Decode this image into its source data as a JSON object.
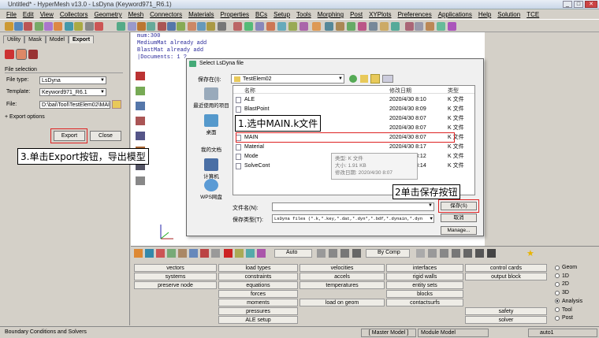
{
  "window": {
    "title": "Untitled* - HyperMesh v13.0 - LsDyna (Keyword971_R6.1)"
  },
  "menu": [
    "File",
    "Edit",
    "View",
    "Collectors",
    "Geometry",
    "Mesh",
    "Connectors",
    "Materials",
    "Properties",
    "BCs",
    "Setup",
    "Tools",
    "Morphing",
    "Post",
    "XYPlots",
    "Preferences",
    "Applications",
    "Help",
    "Solution",
    "TCE"
  ],
  "left_panel": {
    "tabs": [
      "Utility",
      "Mask",
      "Model",
      "Export"
    ],
    "section": "File selection",
    "file_type_label": "File type:",
    "file_type_value": "LsDyna",
    "template_label": "Template:",
    "template_value": "Keyword971_R6.1",
    "file_label": "File:",
    "file_value": "D:\\bai\\Tool\\TestElem02\\MAIN.k",
    "export_options": "Export options",
    "export_button": "Export",
    "close_button": "Close"
  },
  "console": [
    "mum:300",
    "MediumMat already add",
    "BlastMat already add",
    "|Documents: 1 ?"
  ],
  "dialog": {
    "title": "Select LsDyna file",
    "save_in_label": "保存在(I):",
    "save_in_value": "TestElem02",
    "places": [
      "最近使用的项目",
      "桌面",
      "我的文档",
      "计算机",
      "WPS网盘"
    ],
    "columns": [
      "名称",
      "修改日期",
      "类型"
    ],
    "files": [
      {
        "name": "ALE",
        "date": "2020/4/30 8:10",
        "type": "K 文件"
      },
      {
        "name": "BlastPoint",
        "date": "2020/4/30 8:09",
        "type": "K 文件"
      },
      {
        "name": "Boundary",
        "date": "2020/4/30 8:07",
        "type": "K 文件"
      },
      {
        "name": "Definition",
        "date": "2020/4/30 8:07",
        "type": "K 文件"
      },
      {
        "name": "MAIN",
        "date": "2020/4/30 8:07",
        "type": "K 文件"
      },
      {
        "name": "Material",
        "date": "2020/4/30 8:17",
        "type": "K 文件"
      },
      {
        "name": "Mode",
        "date": "2020/4/30 8:12",
        "type": "K 文件"
      },
      {
        "name": "SolveCont",
        "date": "2020/4/30 8:14",
        "type": "K 文件"
      }
    ],
    "tooltip": [
      "类型: K 文件",
      "大小: 1.91 KB",
      "修改日期: 2020/4/30 8:07"
    ],
    "filename_label": "文件名(N):",
    "filename_value": "",
    "savetype_label": "保存类型(T):",
    "savetype_value": "LsDyna files (*.k,*.key,*.dat,*.dyn*,*.bdf,*.dynain,*.dyn",
    "save_button": "保存(S)",
    "cancel_button": "取消",
    "manage_button": "Manage..."
  },
  "annotations": {
    "step1": "1.选中MAIN.k文件",
    "step2": "2单击保存按钮",
    "step3": "3.单击Export按钮，导出模型"
  },
  "bottom_toolbar": {
    "auto": "Auto",
    "bycomp": "By Comp"
  },
  "panel_buttons": [
    [
      "vectors",
      "load types",
      "velocities",
      "interfaces",
      "control cards"
    ],
    [
      "systems",
      "constraints",
      "accels",
      "rigid walls",
      "output block"
    ],
    [
      "preserve node",
      "equations",
      "temperatures",
      "entity sets",
      ""
    ],
    [
      "",
      "forces",
      "",
      "blocks",
      ""
    ],
    [
      "",
      "moments",
      "load on geom",
      "contactsurfs",
      ""
    ],
    [
      "",
      "pressures",
      "",
      "",
      "safety"
    ],
    [
      "",
      "ALE setup",
      "",
      "",
      "solver"
    ]
  ],
  "radios": [
    "Geom",
    "1D",
    "2D",
    "3D",
    "Analysis",
    "Tool",
    "Post"
  ],
  "radio_selected": "Analysis",
  "status": {
    "text": "Boundary Conditions and Solvers",
    "master": "Master Model",
    "module": "Module Model",
    "auto": "auto1"
  }
}
